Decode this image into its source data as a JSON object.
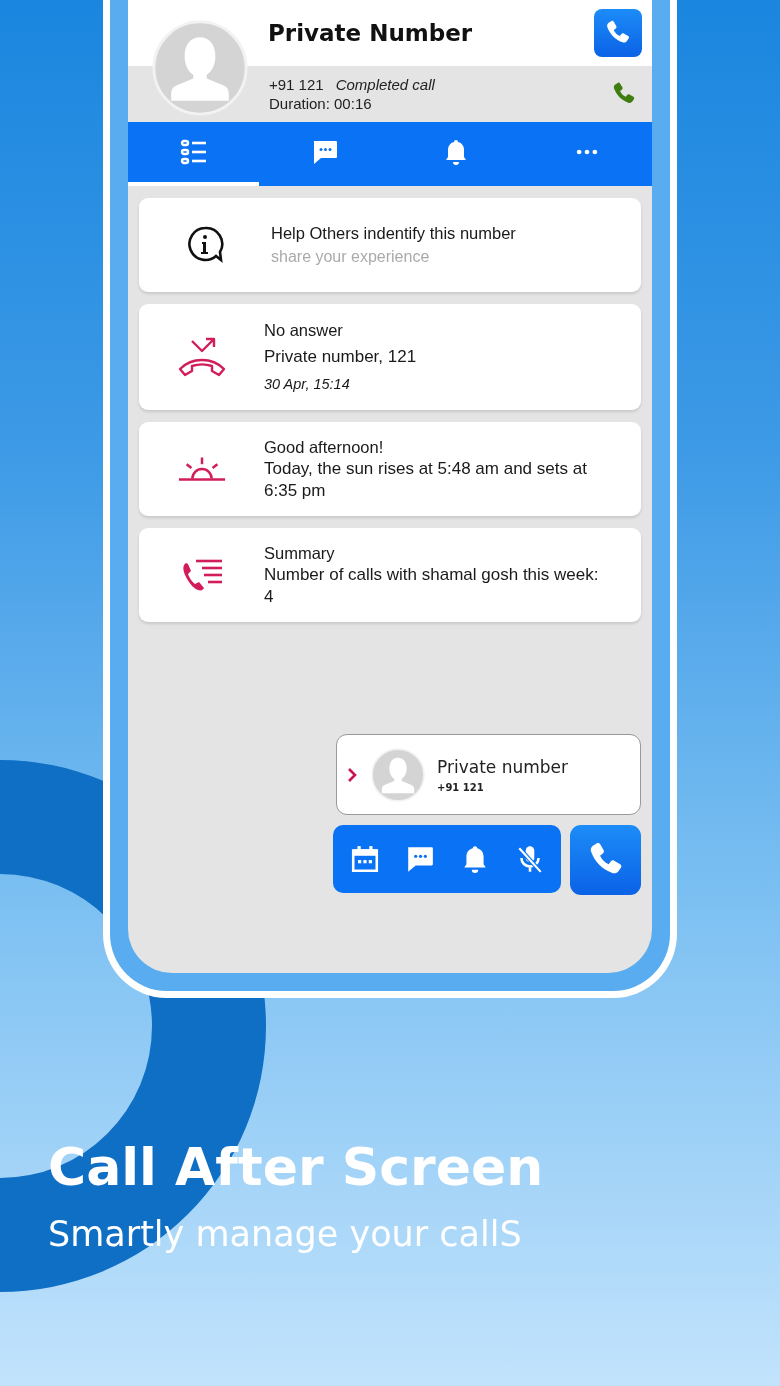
{
  "contact": {
    "name": "Private Number",
    "number": "+91 121",
    "call_status": "Completed call",
    "duration": "Duration: 00:16"
  },
  "tabs": [
    {
      "kind": "list",
      "selected": true
    },
    {
      "kind": "chat",
      "selected": false
    },
    {
      "kind": "bell",
      "selected": false
    },
    {
      "kind": "more",
      "selected": false
    }
  ],
  "cards": [
    {
      "kind": "info",
      "title": "Help Others indentify this number",
      "subtitle": "share your experience"
    },
    {
      "kind": "missed",
      "title": "No answer",
      "detail": "Private number, 121",
      "time": "30 Apr, 15:14"
    },
    {
      "kind": "sun",
      "title": "Good afternoon!",
      "detail": "Today, the sun rises at 5:48 am and sets at 6:35 pm"
    },
    {
      "kind": "summary",
      "title": "Summary",
      "detail": "Number of calls with shamal gosh this week: 4"
    }
  ],
  "mini_card": {
    "name": "Private number",
    "number": "+91 121"
  },
  "actions": [
    {
      "kind": "calendar"
    },
    {
      "kind": "chat"
    },
    {
      "kind": "bell"
    },
    {
      "kind": "mic-off"
    }
  ],
  "headline": "Call After Screen",
  "tagline": "Smartly manage your callS"
}
